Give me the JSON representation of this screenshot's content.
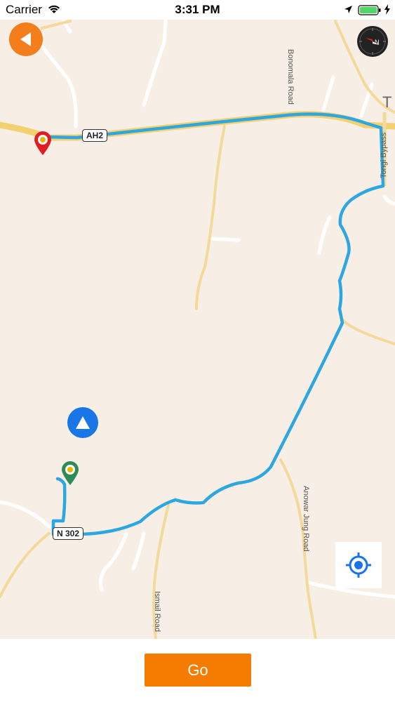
{
  "status_bar": {
    "carrier": "Carrier",
    "time": "3:31 PM"
  },
  "map": {
    "road_labels": {
      "bonomala": "Bonomala Road",
      "tongi_bypass": "Tongi Bypass",
      "anowar_jung": "Anowar Jung Road",
      "ismail": "Ismail Road"
    },
    "shields": {
      "ah2": "AH2",
      "n302": "N 302"
    },
    "edge_letter": "T",
    "route_color": "#2ea7e0",
    "origin_pin_color": "#2e8b57",
    "destination_pin_color": "#e31b23"
  },
  "controls": {
    "back_icon": "back-arrow-icon",
    "compass_icon": "compass-icon",
    "locate_icon": "crosshair-icon",
    "heading_icon": "navigation-triangle-icon",
    "go_label": "Go",
    "accent_color": "#f57c00"
  }
}
